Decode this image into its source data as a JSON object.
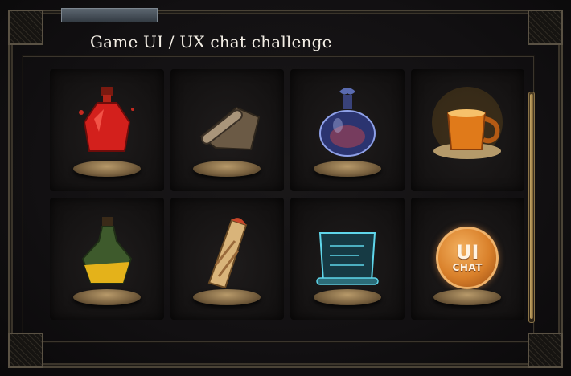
{
  "window": {
    "title": "Game UI / UX chat challenge"
  },
  "inventory": {
    "slots": [
      {
        "item": "red-potion-icon",
        "label": ""
      },
      {
        "item": "scroll-icon",
        "label": ""
      },
      {
        "item": "blue-potion-icon",
        "label": ""
      },
      {
        "item": "mug-icon",
        "label": ""
      },
      {
        "item": "green-potion-icon",
        "label": ""
      },
      {
        "item": "wrap-food-icon",
        "label": ""
      },
      {
        "item": "holo-scroll-icon",
        "label": ""
      },
      {
        "item": "ui-chat-badge-icon",
        "badge_line1": "UI",
        "badge_line2": "CHAT"
      }
    ]
  },
  "colors": {
    "frame_gold": "#8a7348",
    "badge_orange": "#d9802a",
    "holo_cyan": "#5fd6ea"
  }
}
